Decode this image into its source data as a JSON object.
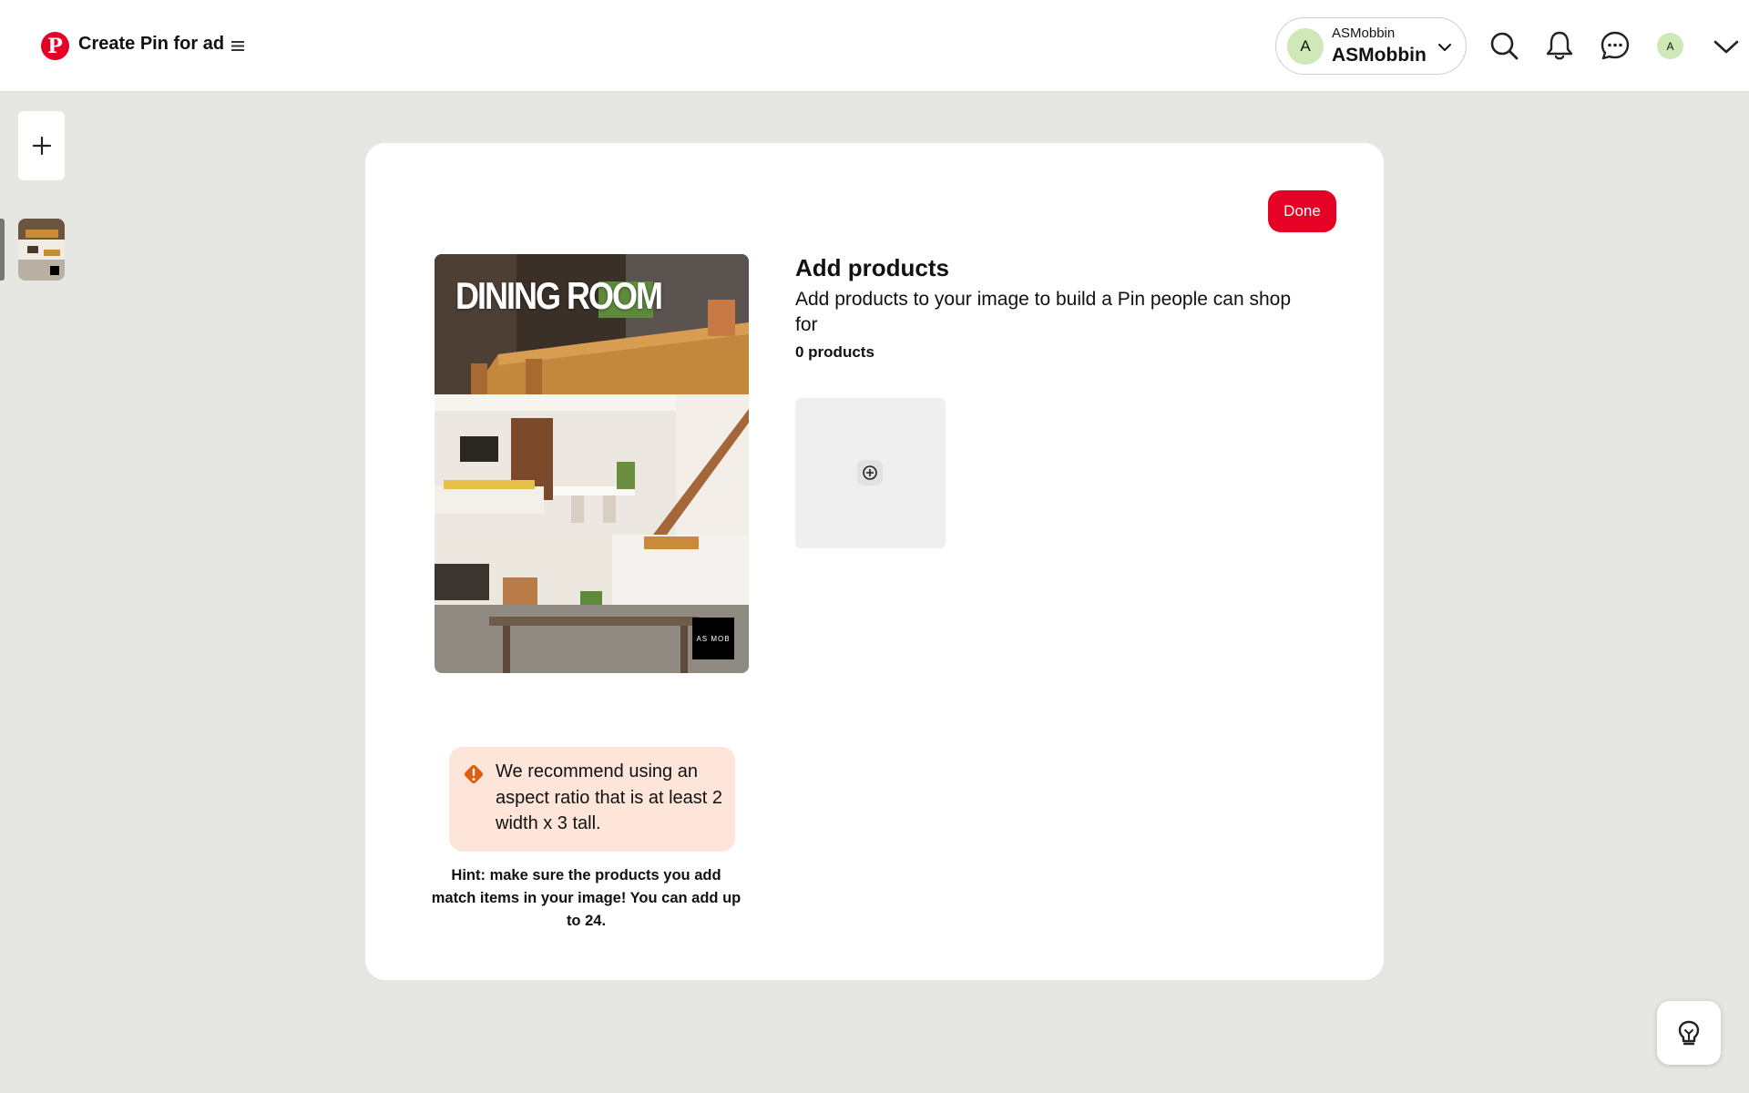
{
  "header": {
    "title": "Create Pin for ad",
    "logo_letter": "P",
    "account": {
      "initial": "A",
      "small_name": "ASMobbin",
      "big_name": "ASMobbin"
    },
    "user_initial": "A",
    "icons": [
      "search-icon",
      "notifications-icon",
      "messages-icon",
      "chevron-down-icon"
    ]
  },
  "sidebar": {
    "add_icon": "plus-icon"
  },
  "editor": {
    "done_label": "Done",
    "image_title": "DINING ROOM",
    "brand_logo": "AS MOB",
    "section_title": "Add products",
    "section_desc": "Add products to your image to build a Pin people can shop for",
    "product_count": "0 products",
    "warning": "We recommend using an aspect ratio that is at least 2 width x 3 tall.",
    "hint": "Hint: make sure the products you add match items in your image! You can add up to 24."
  },
  "colors": {
    "brand_red": "#e60023",
    "background": "#e6e6e2",
    "warning_bg": "#fde6d9",
    "warning_icon": "#e05e12",
    "avatar_bg": "#cfe8b8"
  }
}
